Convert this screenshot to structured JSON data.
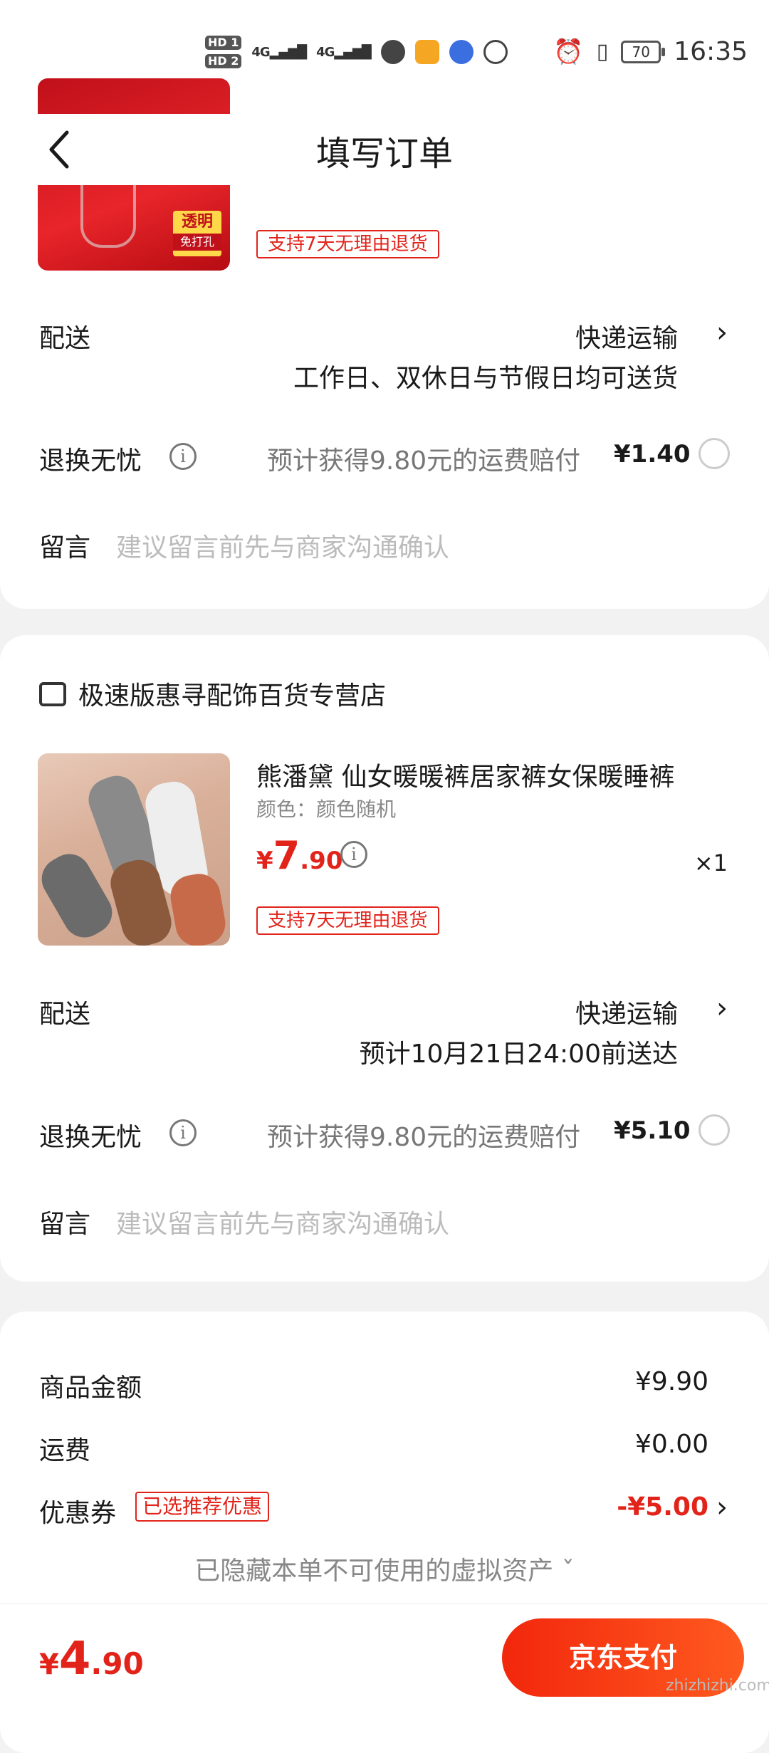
{
  "status_bar": {
    "hd1": "HD 1",
    "hd2": "HD 2",
    "sig1": "4G",
    "sig2": "4G",
    "battery": "70",
    "time": "16:35"
  },
  "header": {
    "title": "填写订单"
  },
  "store1": {
    "thumb_label": "透明",
    "thumb_sub": "免打孔",
    "return_tag": "支持7天无理由退货",
    "delivery_label": "配送",
    "delivery_method": "快递运输",
    "delivery_note": "工作日、双休日与节假日均可送货",
    "insurance_label": "退换无忧",
    "insurance_text": "预计获得9.80元的运费赔付",
    "insurance_price": "¥1.40",
    "message_label": "留言",
    "message_placeholder": "建议留言前先与商家沟通确认"
  },
  "store2": {
    "name": "极速版惠寻配饰百货专营店",
    "product_name": "熊潘黛  仙女暖暖裤居家裤女保暖睡裤",
    "product_spec": "颜色：颜色随机",
    "price_currency": "¥",
    "price_int": "7",
    "price_dec": ".90",
    "quantity": "×1",
    "return_tag": "支持7天无理由退货",
    "delivery_label": "配送",
    "delivery_method": "快递运输",
    "delivery_note": "预计10月21日24:00前送达",
    "insurance_label": "退换无忧",
    "insurance_text": "预计获得9.80元的运费赔付",
    "insurance_price": "¥5.10",
    "message_label": "留言",
    "message_placeholder": "建议留言前先与商家沟通确认"
  },
  "summary": {
    "goods_label": "商品金额",
    "goods_value": "¥9.90",
    "shipping_label": "运费",
    "shipping_value": "¥0.00",
    "coupon_label": "优惠券",
    "coupon_badge": "已选推荐优惠",
    "coupon_value": "-¥5.00",
    "hidden_note": "已隐藏本单不可使用的虚拟资产 ˇ"
  },
  "footer": {
    "total_currency": "¥",
    "total_int": "4",
    "total_dec": ".90",
    "pay_label": "京东支付",
    "watermark": "zhizhizhi.com"
  },
  "colors": {
    "accent": "#e2231a",
    "pay_gradient_start": "#f2270c",
    "pay_gradient_end": "#ff5a1f"
  },
  "icons": [
    "back-icon",
    "info-icon",
    "shop-icon",
    "chevron-right-icon",
    "radio-icon"
  ]
}
